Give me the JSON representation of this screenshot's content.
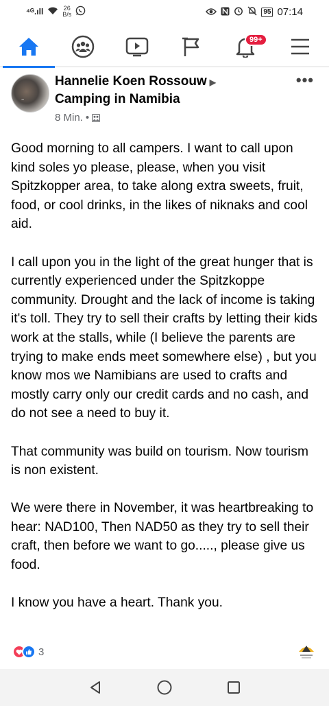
{
  "status_bar": {
    "signal": "⁴ᴳ.ıll",
    "net_speed_value": "26",
    "net_speed_unit": "B/s",
    "battery": "95",
    "time": "07:14"
  },
  "nav": {
    "notifications_badge": "99+"
  },
  "post": {
    "author": "Hannelie Koen Rossouw",
    "group": "Camping in Namibia",
    "time": "8 Min.",
    "separator": "•",
    "paragraphs": [
      "Good morning to all campers. I want to call upon kind soles yo please, please, when you visit Spitzkopper area, to take along extra sweets, fruit, food, or cool drinks, in the likes of niknaks and cool aid.",
      "I call upon you in the light of the great hunger that is currently experienced under the Spitzkoppe community. Drought and the lack of income is taking it's toll.  They try to sell their crafts by letting their kids work at the stalls, while (I believe the parents are trying to make ends meet somewhere else) , but you know mos we Namibians are used to crafts and mostly carry only our credit cards and no cash, and do not see a need to buy it.",
      "That community was build on tourism.  Now tourism is non existent.",
      "We were there in November, it was heartbreaking to hear: NAD100, Then NAD50 as they try to sell their craft,  then before we want to go....., please give us food.",
      "I know you have a heart. Thank you."
    ],
    "reaction_count": "3"
  },
  "colors": {
    "brand_blue": "#1877f2",
    "badge_red": "#e41e3f",
    "love_red": "#f33e58",
    "meta_gray": "#65676b"
  }
}
